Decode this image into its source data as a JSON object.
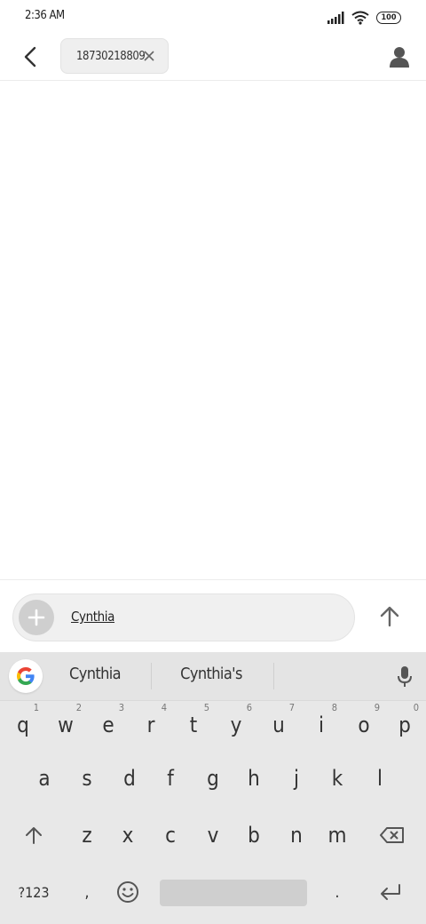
{
  "status": {
    "time": "2:36 AM",
    "battery": "100"
  },
  "header": {
    "recipient": "18730218809"
  },
  "compose": {
    "text": "Cynthia"
  },
  "keyboard": {
    "suggestions": [
      "Cynthia",
      "Cynthia's"
    ],
    "row1": [
      {
        "k": "q",
        "n": "1"
      },
      {
        "k": "w",
        "n": "2"
      },
      {
        "k": "e",
        "n": "3"
      },
      {
        "k": "r",
        "n": "4"
      },
      {
        "k": "t",
        "n": "5"
      },
      {
        "k": "y",
        "n": "6"
      },
      {
        "k": "u",
        "n": "7"
      },
      {
        "k": "i",
        "n": "8"
      },
      {
        "k": "o",
        "n": "9"
      },
      {
        "k": "p",
        "n": "0"
      }
    ],
    "row2": [
      "a",
      "s",
      "d",
      "f",
      "g",
      "h",
      "j",
      "k",
      "l"
    ],
    "row3": [
      "z",
      "x",
      "c",
      "v",
      "b",
      "n",
      "m"
    ],
    "row4": {
      "symbols": "?123",
      "comma": ",",
      "period": "."
    }
  },
  "colors": {
    "keyboard_bg": "#e8e8e8",
    "accent": "#333333"
  },
  "icons": [
    "back-arrow-icon",
    "close-icon",
    "contact-icon",
    "plus-icon",
    "send-arrow-icon",
    "google-icon",
    "mic-icon",
    "shift-icon",
    "backspace-icon",
    "emoji-icon",
    "enter-icon"
  ]
}
